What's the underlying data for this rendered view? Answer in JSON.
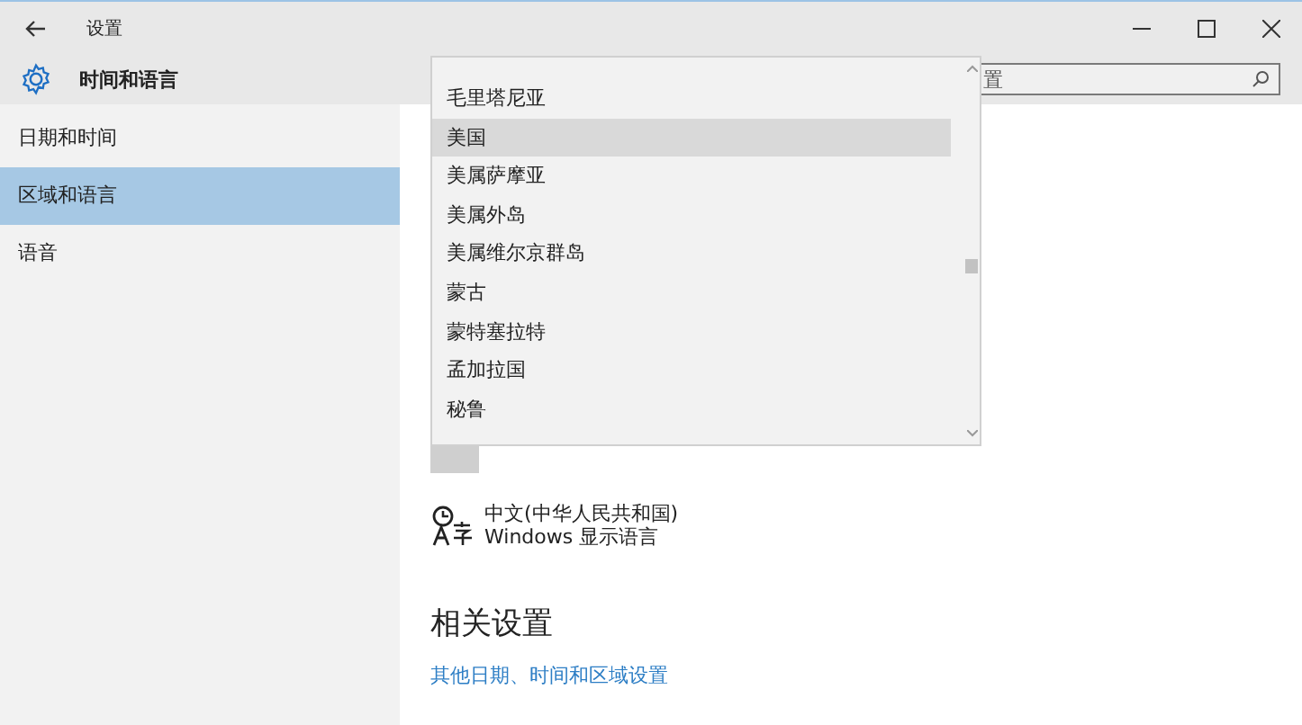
{
  "window": {
    "title": "设置"
  },
  "header": {
    "title": "时间和语言"
  },
  "search": {
    "placeholder": "置"
  },
  "sidebar": {
    "items": [
      {
        "label": "日期和时间",
        "selected": false
      },
      {
        "label": "区域和语言",
        "selected": true
      },
      {
        "label": "语音",
        "selected": false
      }
    ]
  },
  "dropdown": {
    "items": [
      {
        "label": "毛里塔尼亚",
        "selected": false
      },
      {
        "label": "美国",
        "selected": true
      },
      {
        "label": "美属萨摩亚",
        "selected": false
      },
      {
        "label": "美属外岛",
        "selected": false
      },
      {
        "label": "美属维尔京群岛",
        "selected": false
      },
      {
        "label": "蒙古",
        "selected": false
      },
      {
        "label": "蒙特塞拉特",
        "selected": false
      },
      {
        "label": "孟加拉国",
        "selected": false
      },
      {
        "label": "秘鲁",
        "selected": false
      }
    ]
  },
  "language": {
    "name": "中文(中华人民共和国)",
    "description": "Windows 显示语言"
  },
  "related": {
    "heading": "相关设置",
    "link": "其他日期、时间和区域设置"
  }
}
